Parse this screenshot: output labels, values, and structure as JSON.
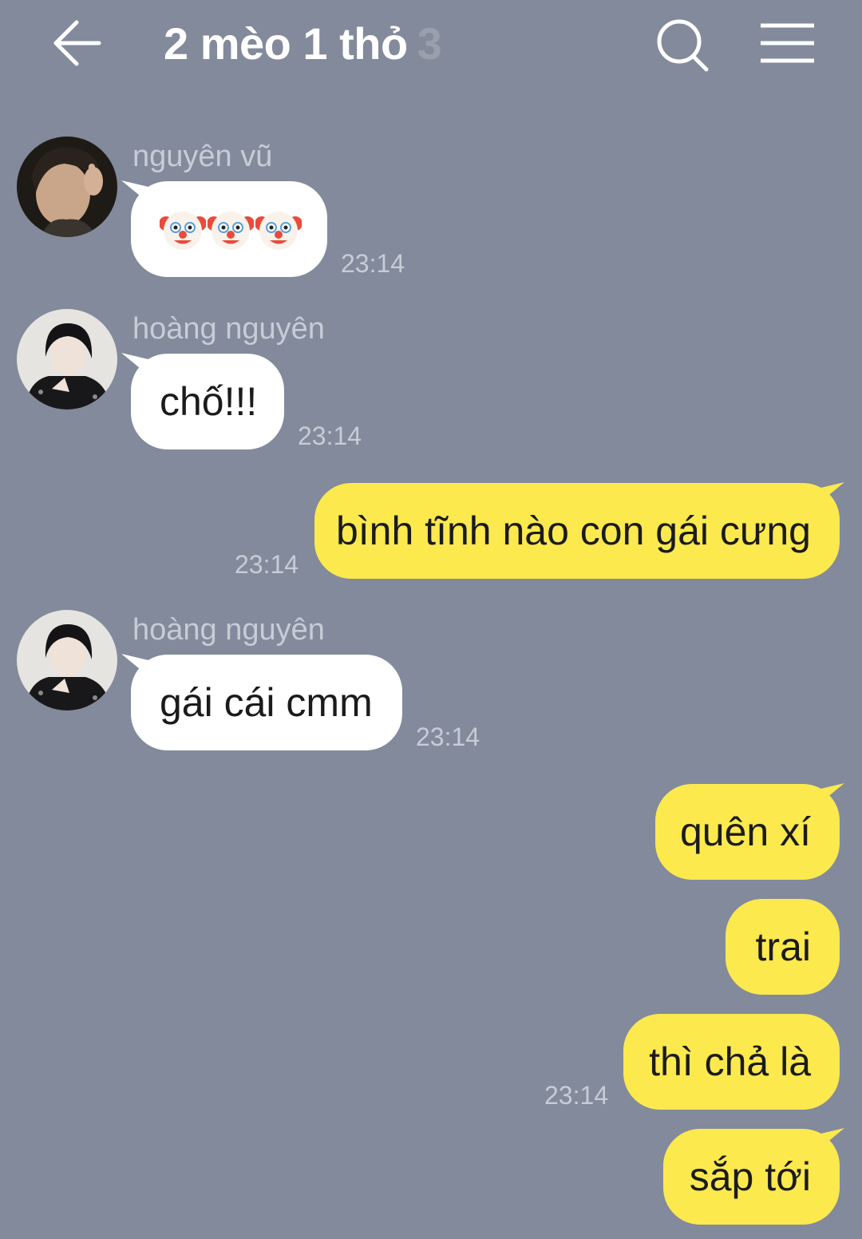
{
  "header": {
    "title": "2 mèo 1 thỏ",
    "member_count": "3",
    "back_icon": "arrow-left-icon",
    "search_icon": "search-icon",
    "menu_icon": "hamburger-menu-icon"
  },
  "colors": {
    "background": "#828a9b",
    "incoming_bubble": "#ffffff",
    "outgoing_bubble": "#fbe94e"
  },
  "messages": [
    {
      "direction": "incoming",
      "sender": "nguyên vũ",
      "content_icon": "clown-face-emoji x3",
      "time": "23:14"
    },
    {
      "direction": "incoming",
      "sender": "hoàng nguyên",
      "text": "chố!!!",
      "time": "23:14"
    },
    {
      "direction": "outgoing",
      "text": "bình tĩnh nào con gái cưng",
      "time": "23:14"
    },
    {
      "direction": "incoming",
      "sender": "hoàng nguyên",
      "text": "gái cái cmm",
      "time": "23:14"
    },
    {
      "direction": "outgoing",
      "text": "quên xí"
    },
    {
      "direction": "outgoing",
      "text": "trai"
    },
    {
      "direction": "outgoing",
      "text": "thì chả là",
      "time": "23:14"
    },
    {
      "direction": "outgoing",
      "text": "sắp tới"
    }
  ]
}
